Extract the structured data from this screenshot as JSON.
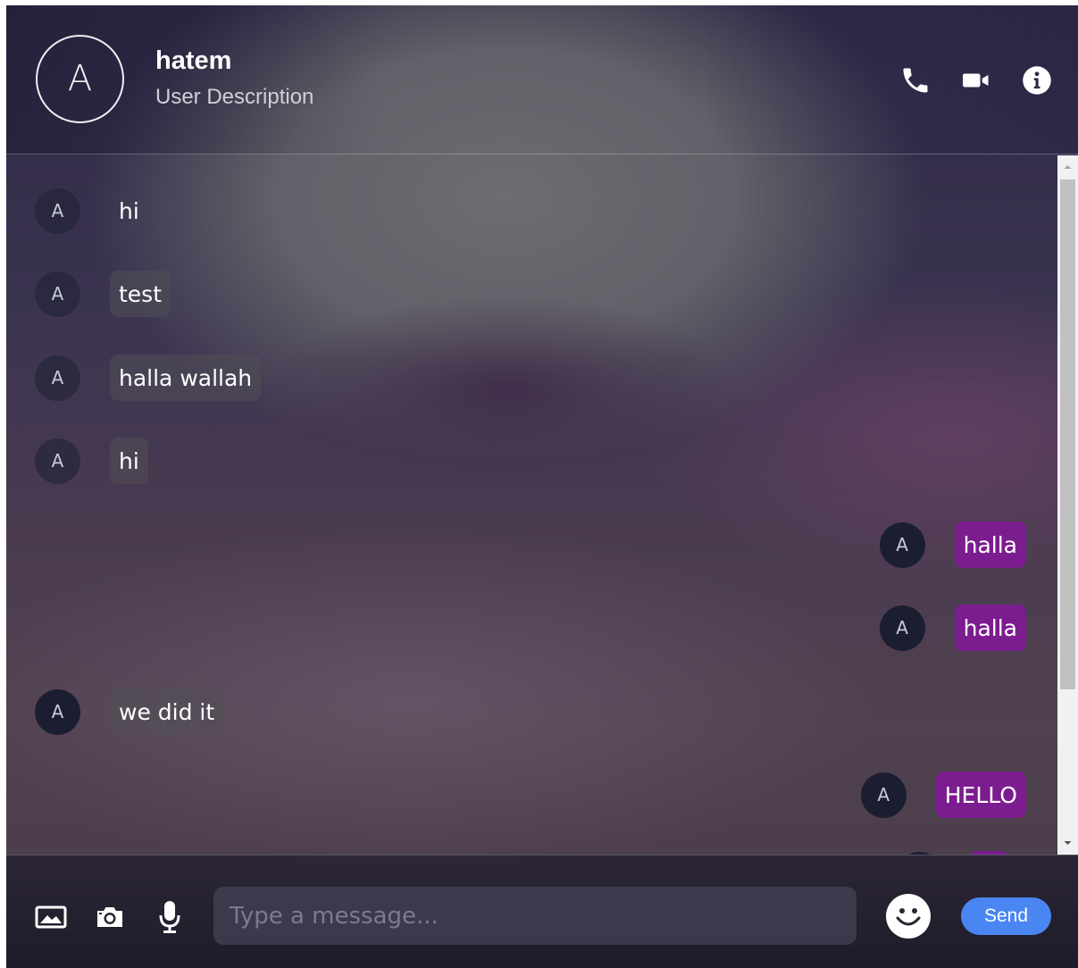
{
  "header": {
    "avatar_initial": "A",
    "user_name": "hatem",
    "user_description": "User Description",
    "icons": [
      "phone-icon",
      "video-camera-icon",
      "info-icon"
    ]
  },
  "messages": [
    {
      "direction": "in",
      "avatar": "A",
      "text": "hi"
    },
    {
      "direction": "in",
      "avatar": "A",
      "text": "test"
    },
    {
      "direction": "in",
      "avatar": "A",
      "text": "halla wallah"
    },
    {
      "direction": "in",
      "avatar": "A",
      "text": "hi"
    },
    {
      "direction": "out",
      "avatar": "A",
      "text": "halla"
    },
    {
      "direction": "out",
      "avatar": "A",
      "text": "halla"
    },
    {
      "direction": "in",
      "avatar": "A",
      "text": "we did it"
    },
    {
      "direction": "out",
      "avatar": "A",
      "text": "HELLO"
    }
  ],
  "composer": {
    "placeholder": "Type a message...",
    "value": "",
    "send_label": "Send",
    "icons": [
      "image-icon",
      "camera-icon",
      "microphone-icon",
      "emoji-icon"
    ]
  },
  "colors": {
    "outgoing_bubble": "#7c1d8f",
    "avatar_bg": "#1b1e31",
    "send_button": "#4a86f2"
  }
}
